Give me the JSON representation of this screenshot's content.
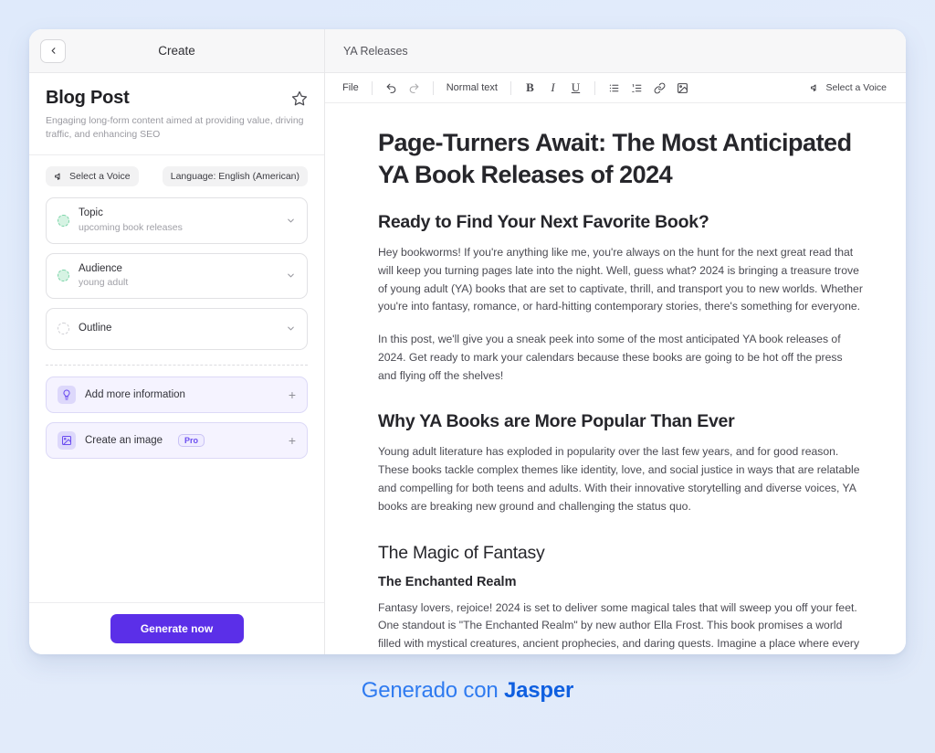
{
  "sidebar": {
    "back_icon": "chevron-left-icon",
    "header_title": "Create",
    "template": {
      "title": "Blog Post",
      "description": "Engaging long-form content aimed at providing value, driving traffic, and enhancing SEO",
      "favorite_icon": "star-icon"
    },
    "chips": {
      "voice_icon": "megaphone-icon",
      "voice_label": "Select a Voice",
      "language_label": "Language: English (American)"
    },
    "fields": [
      {
        "label": "Topic",
        "value": "upcoming book releases",
        "filled": true
      },
      {
        "label": "Audience",
        "value": "young adult",
        "filled": true
      },
      {
        "label": "Outline",
        "value": "",
        "filled": false
      }
    ],
    "actions": [
      {
        "label": "Add more information",
        "icon": "lightbulb-icon",
        "badge": "",
        "plus": "+"
      },
      {
        "label": "Create an image",
        "icon": "image-icon",
        "badge": "Pro",
        "plus": "+"
      }
    ],
    "generate_label": "Generate now"
  },
  "editor": {
    "doc_title": "YA Releases",
    "toolbar": {
      "file_label": "File",
      "undo_icon": "undo-icon",
      "redo_icon": "redo-icon",
      "style_label": "Normal text",
      "bold_label": "B",
      "italic_label": "I",
      "underline_label": "U",
      "bullet_list_icon": "bullet-list-icon",
      "numbered_list_icon": "numbered-list-icon",
      "link_icon": "link-icon",
      "image_icon": "image-icon",
      "voice_icon": "megaphone-icon",
      "voice_label": "Select a Voice"
    },
    "document": {
      "h1": "Page-Turners Await: The Most Anticipated YA Book Releases of 2024",
      "h2_intro": "Ready to Find Your Next Favorite Book?",
      "p1": "Hey bookworms! If you're anything like me, you're always on the hunt for the next great read that will keep you turning pages late into the night. Well, guess what? 2024 is bringing a treasure trove of young adult (YA) books that are set to captivate, thrill, and transport you to new worlds. Whether you're into fantasy, romance, or hard-hitting contemporary stories, there's something for everyone.",
      "p2": "In this post, we'll give you a sneak peek into some of the most anticipated YA book releases of 2024. Get ready to mark your calendars because these books are going to be hot off the press and flying off the shelves!",
      "h2_popular": "Why YA Books are More Popular Than Ever",
      "p3": "Young adult literature has exploded in popularity over the last few years, and for good reason. These books tackle complex themes like identity, love, and social justice in ways that are relatable and compelling for both teens and adults. With their innovative storytelling and diverse voices, YA books are breaking new ground and challenging the status quo.",
      "h2_magic": "The Magic of Fantasy",
      "h3_realm": "The Enchanted Realm",
      "p4": "Fantasy lovers, rejoice! 2024 is set to deliver some magical tales that will sweep you off your feet. One standout is \"The Enchanted Realm\" by new author Ella Frost. This book promises a world filled with mystical creatures, ancient prophecies, and daring quests. Imagine a place where every step you take could lead to adventure or danger."
    }
  },
  "footer": {
    "caption_prefix": "Generado con ",
    "brand": "Jasper"
  }
}
